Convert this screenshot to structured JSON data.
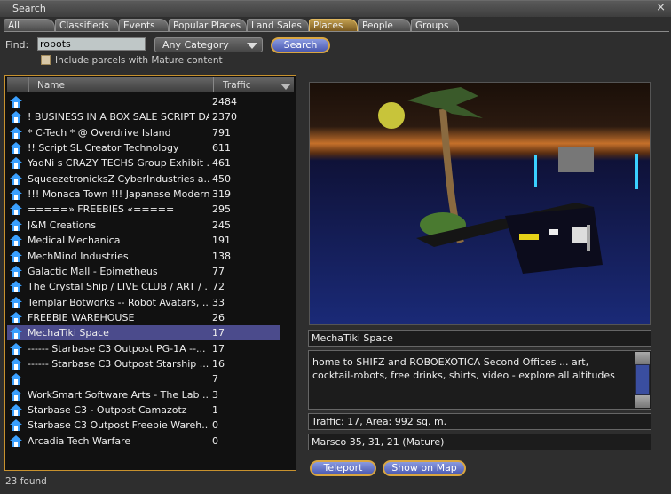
{
  "window": {
    "title": "Search"
  },
  "tabs": [
    "All",
    "Classifieds",
    "Events",
    "Popular Places",
    "Land Sales",
    "Places",
    "People",
    "Groups"
  ],
  "active_tab": "Places",
  "find": {
    "label": "Find:",
    "value": "robots",
    "category": "Any Category",
    "search_label": "Search",
    "mature_label": "Include parcels with Mature content"
  },
  "list": {
    "col_name": "Name",
    "col_traffic": "Traffic",
    "rows": [
      {
        "name": "",
        "traffic": "2484"
      },
      {
        "name": "! BUSINESS IN A BOX SALE SCRIPT DA...",
        "traffic": "2370"
      },
      {
        "name": "* C-Tech * @ Overdrive Island",
        "traffic": "791"
      },
      {
        "name": "!! Script SL Creator Technology",
        "traffic": "611"
      },
      {
        "name": "YadNi s CRAZY TECHS Group Exhibit ...",
        "traffic": "461"
      },
      {
        "name": "SqueezetronicksZ CyberIndustries a...",
        "traffic": "450"
      },
      {
        "name": "!!! Monaca Town !!! Japanese Modern !",
        "traffic": "319"
      },
      {
        "name": "=====» FREEBIES «=====",
        "traffic": "295"
      },
      {
        "name": "J&M Creations",
        "traffic": "245"
      },
      {
        "name": "Medical Mechanica",
        "traffic": "191"
      },
      {
        "name": "MechMind Industries",
        "traffic": "138"
      },
      {
        "name": "Galactic Mall - Epimetheus",
        "traffic": "77"
      },
      {
        "name": "The Crystal Ship / LIVE CLUB / ART / ...",
        "traffic": "72"
      },
      {
        "name": "Templar Botworks -- Robot Avatars, ...",
        "traffic": "33"
      },
      {
        "name": "FREEBIE WAREHOUSE",
        "traffic": "26"
      },
      {
        "name": "MechaTiki Space",
        "traffic": "17"
      },
      {
        "name": "------ Starbase C3 Outpost PG-1A --...",
        "traffic": "17"
      },
      {
        "name": "------ Starbase C3 Outpost Starship ...",
        "traffic": "16"
      },
      {
        "name": "",
        "traffic": "7"
      },
      {
        "name": "WorkSmart Software Arts - The Lab ...",
        "traffic": "3"
      },
      {
        "name": "Starbase C3 - Outpost Camazotz",
        "traffic": "1"
      },
      {
        "name": "Starbase C3 Outpost Freebie Wareh...",
        "traffic": "0"
      },
      {
        "name": "Arcadia Tech Warfare",
        "traffic": "0"
      }
    ],
    "selected": "MechaTiki Space",
    "found": "23 found"
  },
  "details": {
    "name": "MechaTiki Space",
    "description": "home to SHIFZ and ROBOEXOTICA Second Offices ... art, cocktail-robots, free drinks, shirts, video - explore all altitudes",
    "traffic_area": "Traffic: 17, Area: 992 sq. m.",
    "location": "Marsco 35, 31, 21 (Mature)",
    "teleport_label": "Teleport",
    "map_label": "Show on Map"
  }
}
